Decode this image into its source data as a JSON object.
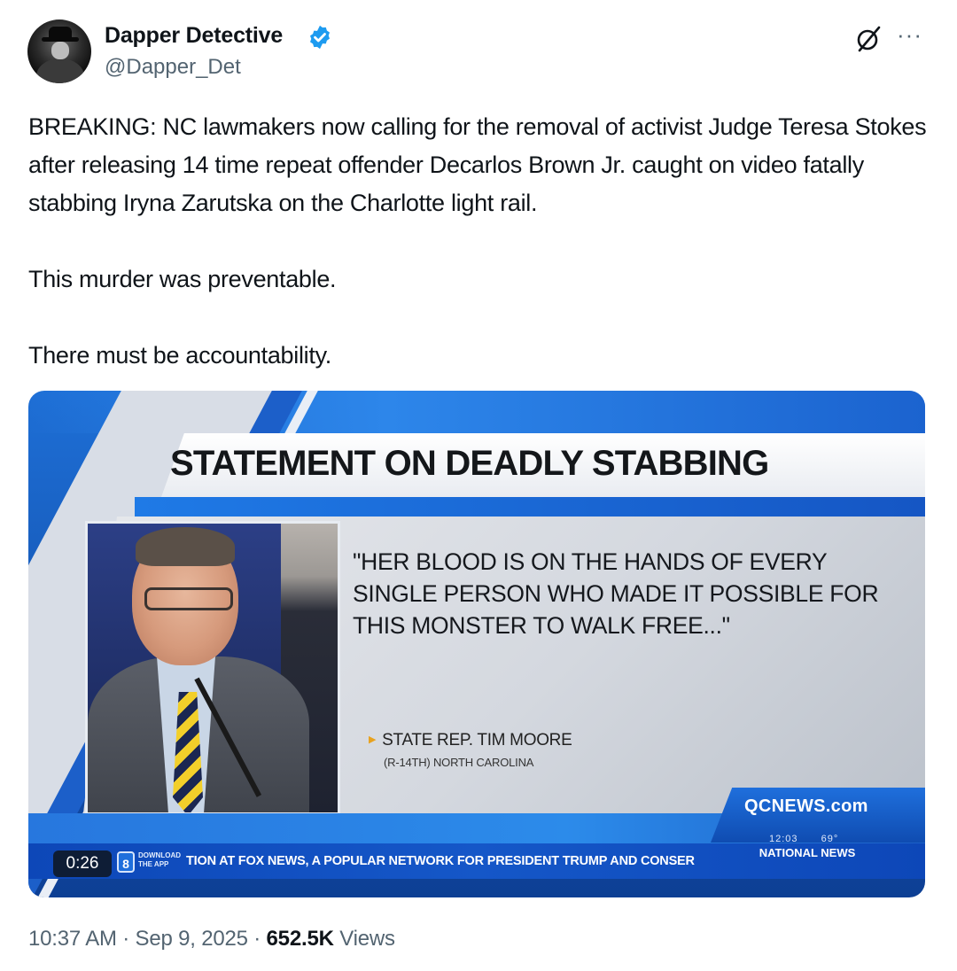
{
  "author": {
    "display_name": "Dapper Detective",
    "handle": "@Dapper_Det",
    "verified": true,
    "avatar_icon": "detective-avatar-icon"
  },
  "header_actions": {
    "grok_icon": "grok-icon",
    "more_icon": "more-options-icon",
    "more_glyph": "···"
  },
  "tweet": {
    "paragraphs": [
      "BREAKING: NC lawmakers now calling for the removal of activist Judge Teresa Stokes after releasing 14 time repeat offender Decarlos Brown Jr. caught on video fatally stabbing Iryna Zarutska on the Charlotte light rail.",
      "This murder was preventable.",
      "There must be accountability."
    ]
  },
  "media": {
    "headline": "STATEMENT ON DEADLY STABBING",
    "quote": "\"HER BLOOD IS ON THE HANDS OF EVERY SINGLE PERSON WHO MADE IT POSSIBLE FOR THIS MONSTER TO WALK FREE...\"",
    "speaker_name": "STATE REP. TIM MOORE",
    "speaker_title": "(R-14TH) NORTH CAROLINA",
    "station_logo": "QCNEWS.com",
    "time": "12:03",
    "temperature": "69°",
    "ticker_text": "TION AT FOX NEWS, A POPULAR NETWORK FOR PRESIDENT TRUMP AND CONSER",
    "ticker_badge": "NATIONAL NEWS",
    "download_label": "DOWNLOAD THE APP",
    "duration": "0:26"
  },
  "meta": {
    "time": "10:37 AM",
    "separator": "·",
    "date": "Sep 9, 2025",
    "views_count": "652.5K",
    "views_label": "Views"
  },
  "colors": {
    "verified_blue": "#1d9bf0",
    "secondary_text": "#536471",
    "primary_text": "#0f1419",
    "broadcast_blue": "#1557c8"
  }
}
